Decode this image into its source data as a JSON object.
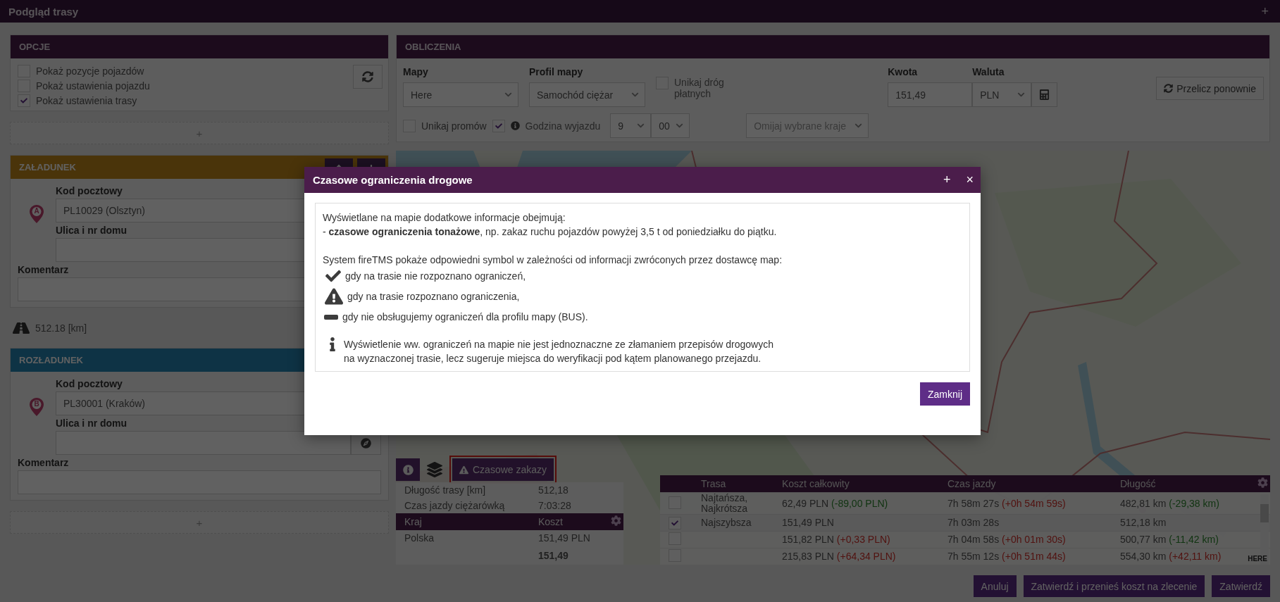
{
  "window": {
    "title": "Podgląd trasy",
    "add_button": "+"
  },
  "options": {
    "title": "OPCJE",
    "checkboxes": [
      {
        "label": "Pokaż pozycje pojazdów",
        "checked": false
      },
      {
        "label": "Pokaż ustawienia pojazdu",
        "checked": false
      },
      {
        "label": "Pokaż ustawienia trasy",
        "checked": true
      }
    ],
    "add_button": "+"
  },
  "loading": {
    "title": "ZAŁADUNEK",
    "marker": "A",
    "postal_label": "Kod pocztowy",
    "postal_value": "PL10029 (Olsztyn)",
    "street_label": "Ulica i nr domu",
    "comment_label": "Komentarz",
    "move_buttons": true
  },
  "distance": "512.18 [km]",
  "unloading": {
    "title": "ROZŁADUNEK",
    "marker": "B",
    "postal_label": "Kod pocztowy",
    "postal_value": "PL30001 (Kraków)",
    "street_label": "Ulica i nr domu",
    "comment_label": "Komentarz",
    "locate_button": true
  },
  "add_stop_button": "+",
  "calculations": {
    "title": "OBLICZENIA",
    "maps_label": "Mapy",
    "maps_value": "Here",
    "profile_label": "Profil mapy",
    "profile_value": "Samochód ciężar",
    "avoid_tolls": {
      "label": "Unikaj dróg płatnych",
      "checked": false
    },
    "amount_label": "Kwota",
    "amount_value": "151,49",
    "currency_label": "Waluta",
    "currency_value": "PLN",
    "recalculate_button": "Przelicz ponownie",
    "avoid_ferries": {
      "label": "Unikaj promów",
      "checked": false
    },
    "departure": {
      "label": "Godzina wyjazdu",
      "checked": true,
      "hour": "9",
      "minute": "00"
    },
    "countries_placeholder": "Omijaj wybrane kraje"
  },
  "map": {
    "restrictions_button": {
      "label": "Czasowe zakazy",
      "highlighted": true
    },
    "summary": [
      {
        "label": "Długość trasy [km]",
        "value": "512,18"
      },
      {
        "label": "Czas jazdy ciężarówką",
        "value": "7:03:28"
      }
    ],
    "costs": {
      "columns": [
        "Kraj",
        "Koszt"
      ],
      "rows": [
        [
          "Polska",
          "151,49 PLN"
        ]
      ],
      "total": "151,49"
    },
    "attribution": "HERE"
  },
  "routes": {
    "columns": [
      "Trasa",
      "Koszt całkowity",
      "Czas jazdy",
      "Długość"
    ],
    "rows": [
      {
        "selected": false,
        "name": "Najtańsza, Najkrótsza",
        "cost": "62,49 PLN",
        "cost_diff": {
          "text": "(-89,00 PLN)",
          "kind": "decrease"
        },
        "time": "7h 58m 27s",
        "time_diff": {
          "text": "(+0h 54m 59s)",
          "kind": "increase"
        },
        "length": "482,81 km",
        "length_diff": {
          "text": "(-29,38 km)",
          "kind": "decrease"
        }
      },
      {
        "selected": true,
        "name": "Najszybsza",
        "cost": "151,49 PLN",
        "time": "7h 03m 28s",
        "length": "512,18 km"
      },
      {
        "selected": false,
        "cost": "151,82 PLN",
        "cost_diff": {
          "text": "(+0,33 PLN)",
          "kind": "increase"
        },
        "time": "7h 04m 58s",
        "time_diff": {
          "text": "(+0h 01m 30s)",
          "kind": "increase"
        },
        "length": "500,77 km",
        "length_diff": {
          "text": "(-11,42 km)",
          "kind": "decrease"
        }
      },
      {
        "selected": false,
        "cost": "215,83 PLN",
        "cost_diff": {
          "text": "(+64,34 PLN)",
          "kind": "increase"
        },
        "time": "7h 55m 12s",
        "time_diff": {
          "text": "(+0h 51m 44s)",
          "kind": "increase"
        },
        "length": "554,30 km",
        "length_diff": {
          "text": "(+42,11 km)",
          "kind": "increase"
        }
      }
    ]
  },
  "buttons": [
    "Anuluj",
    "Zatwierdź i przenieś koszt na zlecenie",
    "Zatwierdź"
  ],
  "dialog": {
    "title": "Czasowe ograniczenia drogowe",
    "expand_button": "+",
    "close_button": "×",
    "intro": "Wyświetlane na mapie dodatkowe informacje obejmują:",
    "item": "- **czasowe ograniczenia tonażowe**, np. zakaz ruchu pojazdów powyżej 3,5 t od poniedziałku do piątku.",
    "legend_intro": "System fireTMS pokaże odpowiedni symbol w zależności od informacji zwróconych przez dostawcę map:",
    "legend": [
      {
        "kind": "check",
        "text": "gdy na trasie nie rozpoznano ograniczeń,"
      },
      {
        "kind": "warning",
        "text": "gdy na trasie rozpoznano ograniczenia,"
      },
      {
        "kind": "dash",
        "text": "gdy nie obsługujemy ograniczeń dla profilu mapy (BUS)."
      }
    ],
    "note_lines": [
      "Wyświetlenie ww. ograniczeń na mapie nie jest jednoznaczne ze złamaniem przepisów drogowych",
      "na wyznaczonej trasie, lecz sugeruje miejsca do weryfikacji pod kątem planowanego przejazdu."
    ],
    "close_label": "Zamknij"
  }
}
